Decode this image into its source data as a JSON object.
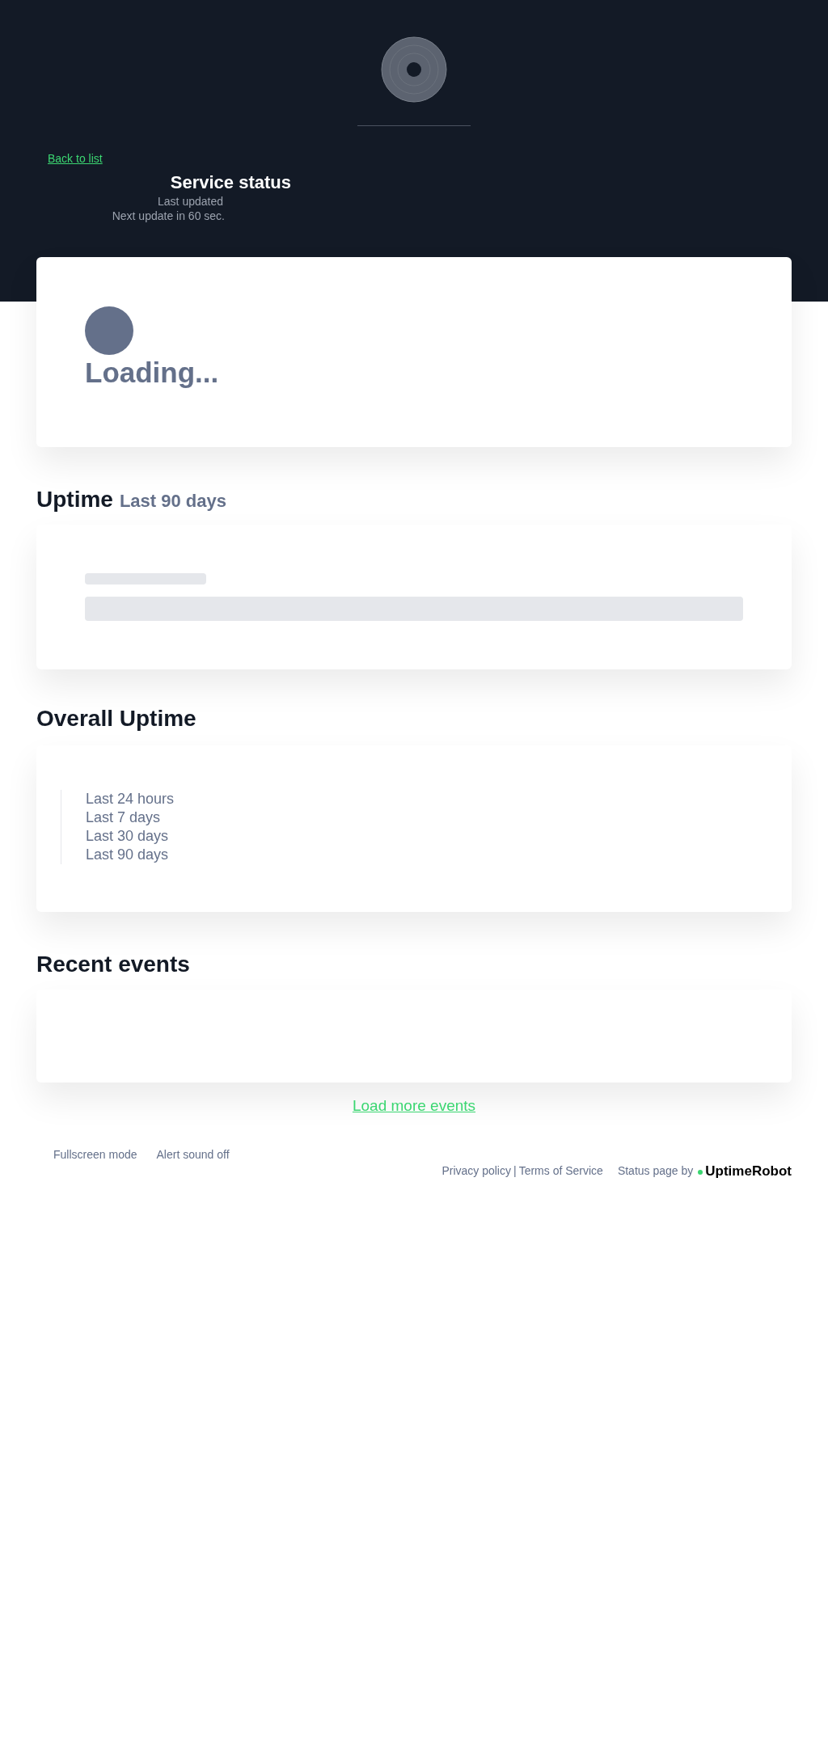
{
  "header": {
    "back_link": "Back to list",
    "title": "Service status",
    "last_updated": "Last updated",
    "next_update": "Next update in 60 sec."
  },
  "monitor": {
    "status": "Loading..."
  },
  "uptime": {
    "title": "Uptime",
    "subtitle": "Last 90 days"
  },
  "overall_uptime": {
    "title": "Overall Uptime",
    "periods": [
      "Last 24 hours",
      "Last 7 days",
      "Last 30 days",
      "Last 90 days"
    ]
  },
  "recent_events": {
    "title": "Recent events",
    "load_more": "Load more events"
  },
  "footer": {
    "left": [
      "Fullscreen mode",
      "Alert sound off"
    ],
    "links": [
      "Privacy policy",
      "Terms of Service"
    ],
    "separator": "|",
    "powered_by": "Status page by",
    "brand": "UptimeRobot"
  }
}
